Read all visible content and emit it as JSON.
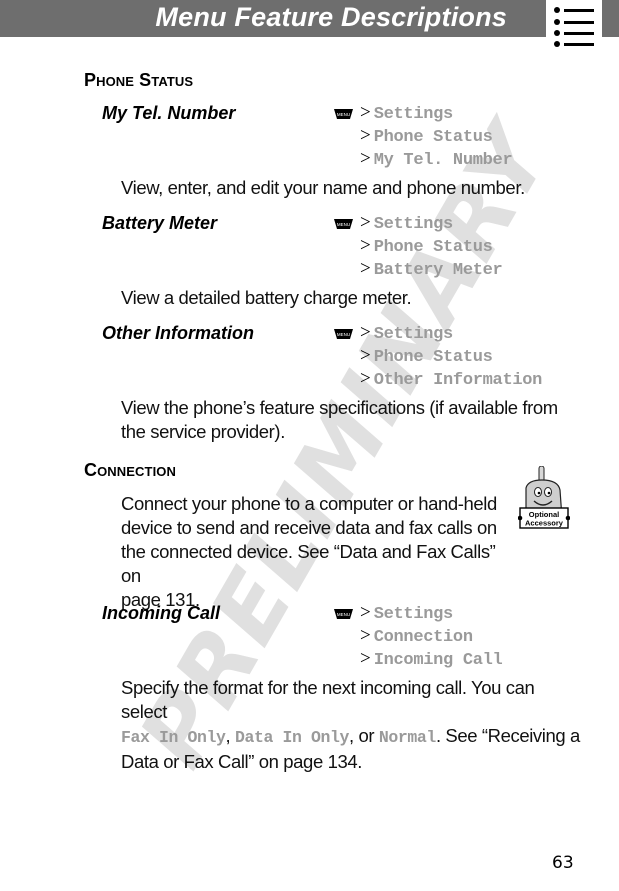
{
  "header": {
    "title": "Menu Feature Descriptions",
    "tab_icon": "menu-list-icon"
  },
  "watermark": "PRELIMINARY",
  "menu_key_label": "MENU",
  "path_separator": ">",
  "sections": [
    {
      "heading": "Phone Status",
      "features": [
        {
          "title": "My Tel. Number",
          "path": [
            "Settings",
            "Phone Status",
            "My Tel. Number"
          ],
          "description": "View, enter, and edit your name and phone number."
        },
        {
          "title": "Battery Meter",
          "path": [
            "Settings",
            "Phone Status",
            "Battery Meter"
          ],
          "description": "View a detailed battery charge meter."
        },
        {
          "title": "Other Information",
          "path": [
            "Settings",
            "Phone Status",
            "Other Information"
          ],
          "description_lines": [
            "View the phone’s feature specifications (if available from",
            "the service provider)."
          ]
        }
      ]
    },
    {
      "heading": "Connection",
      "intro_lines": [
        "Connect your phone to a computer or hand-held",
        "device to send and receive data and fax calls on",
        "the connected device. See “Data and Fax Calls” on",
        "page 131."
      ],
      "badge": {
        "icon": "optional-accessory-icon",
        "line1": "Optional",
        "line2": "Accessory"
      },
      "features": [
        {
          "title": "Incoming Call",
          "path": [
            "Settings",
            "Connection",
            "Incoming Call"
          ],
          "description": {
            "line1": "Specify the format for the next incoming call. You can select",
            "option1": "Fax In Only",
            "sep1": ", ",
            "option2": "Data In Only",
            "sep2": ", or ",
            "option3": "Normal",
            "tail": ". See “Receiving a",
            "line3": "Data or Fax Call” on page 134."
          }
        }
      ]
    }
  ],
  "page_number": "63"
}
